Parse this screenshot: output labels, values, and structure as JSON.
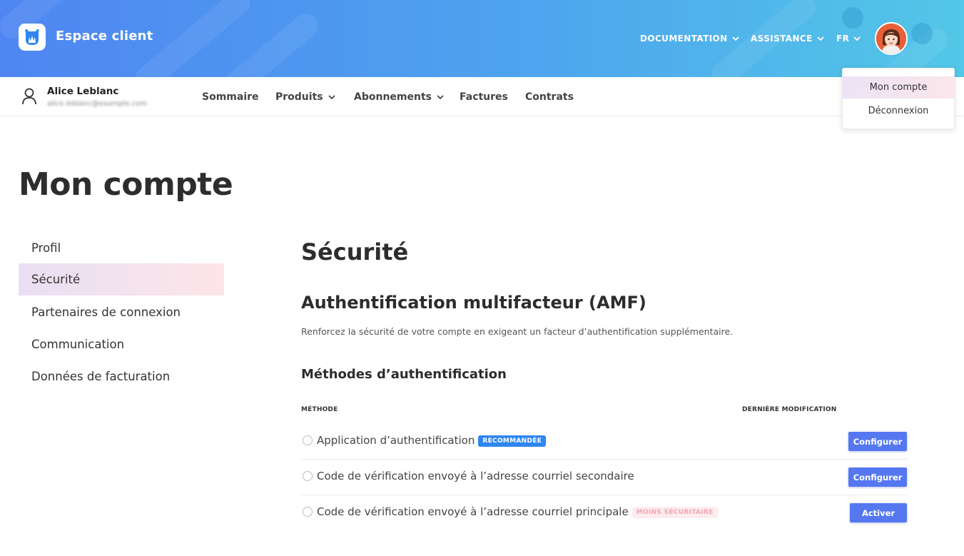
{
  "header": {
    "brand": "Espace client",
    "nav": [
      {
        "label": "DOCUMENTATION"
      },
      {
        "label": "ASSISTANCE"
      },
      {
        "label": "FR"
      }
    ],
    "colors": {
      "gradient_start": "#4f86f2",
      "gradient_end": "#52c7e7"
    }
  },
  "account_menu": {
    "items": [
      {
        "label": "Mon compte",
        "active": true
      },
      {
        "label": "Déconnexion",
        "active": false
      }
    ]
  },
  "user": {
    "name": "Alice Leblanc",
    "email": "alice.leblanc@example.com"
  },
  "subnav": {
    "items": [
      {
        "label": "Sommaire",
        "has_dropdown": false
      },
      {
        "label": "Produits",
        "has_dropdown": true
      },
      {
        "label": "Abonnements",
        "has_dropdown": true
      },
      {
        "label": "Factures",
        "has_dropdown": false
      },
      {
        "label": "Contrats",
        "has_dropdown": false
      }
    ]
  },
  "page": {
    "title": "Mon compte"
  },
  "sidebar": {
    "items": [
      {
        "label": "Profil",
        "active": false
      },
      {
        "label": "Sécurité",
        "active": true
      },
      {
        "label": "Partenaires de connexion",
        "active": false
      },
      {
        "label": "Communication",
        "active": false
      },
      {
        "label": "Données de facturation",
        "active": false
      }
    ]
  },
  "security": {
    "title": "Sécurité",
    "mfa_title": "Authentification multifacteur (AMF)",
    "mfa_description": "Renforcez la sécurité de votre compte en exigeant un facteur d’authentification supplémentaire.",
    "methods_title": "Méthodes d’authentification",
    "columns": {
      "method": "MÉTHODE",
      "last_modified": "DERNIÈRE MODIFICATION"
    },
    "methods": [
      {
        "label": "Application d’authentification",
        "badge": "RECOMMANDÉE",
        "badge_color": "#2f86ef",
        "action": "Configurer"
      },
      {
        "label": "Code de vérification envoyé à l’adresse courriel secondaire",
        "badge": "",
        "action": "Configurer"
      },
      {
        "label": "Code de vérification envoyé à l’adresse courriel principale",
        "badge": "MOINS SÉCURITAIRE",
        "badge_color": "#f2a5b2",
        "action": "Activer"
      }
    ]
  }
}
